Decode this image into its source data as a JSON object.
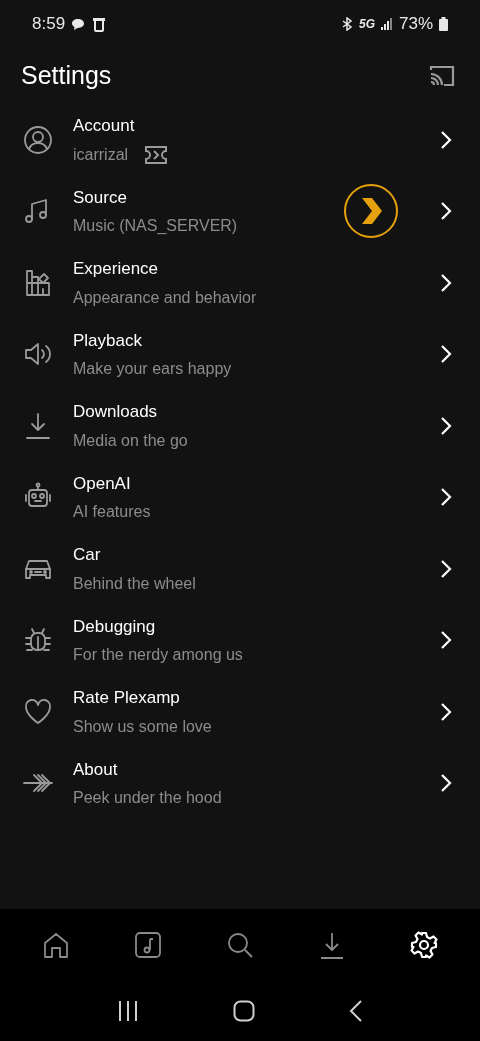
{
  "status_bar": {
    "time": "8:59",
    "network": "5G",
    "battery": "73%"
  },
  "header": {
    "title": "Settings"
  },
  "items": [
    {
      "title": "Account",
      "subtitle": "icarrizal"
    },
    {
      "title": "Source",
      "subtitle": "Music (NAS_SERVER)"
    },
    {
      "title": "Experience",
      "subtitle": "Appearance and behavior"
    },
    {
      "title": "Playback",
      "subtitle": "Make your ears happy"
    },
    {
      "title": "Downloads",
      "subtitle": "Media on the go"
    },
    {
      "title": "OpenAI",
      "subtitle": "AI features"
    },
    {
      "title": "Car",
      "subtitle": "Behind the wheel"
    },
    {
      "title": "Debugging",
      "subtitle": "For the nerdy among us"
    },
    {
      "title": "Rate Plexamp",
      "subtitle": "Show us some love"
    },
    {
      "title": "About",
      "subtitle": "Peek under the hood"
    }
  ],
  "bottom_nav": [
    {
      "selected": false
    },
    {
      "selected": false
    },
    {
      "selected": false
    },
    {
      "selected": false
    },
    {
      "selected": true
    }
  ]
}
